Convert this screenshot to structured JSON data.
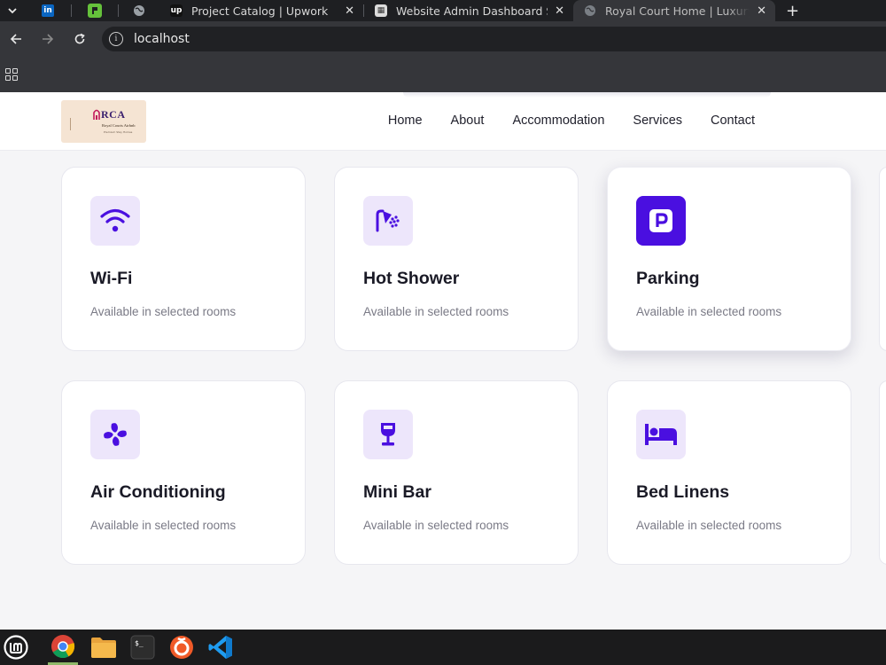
{
  "browser": {
    "pinned_tabs": [
      {
        "icon": "linkedin-icon",
        "label": "in",
        "color": "#0a66c2"
      },
      {
        "icon": "green-app-icon",
        "label": "",
        "color": "#65c13b"
      }
    ],
    "tabs": [
      {
        "title": "Project Catalog | Upwork",
        "icon": "upwork-icon",
        "active": false
      },
      {
        "title": "Website Admin Dashboard S",
        "icon": "dashboard-icon",
        "active": false
      },
      {
        "title": "Royal Court Home | Luxury A",
        "icon": "globe-icon",
        "active": true
      }
    ],
    "address": "localhost"
  },
  "site": {
    "logo": {
      "mark": "RCA",
      "name": "Royal Courts Airbnb",
      "tagline": "Premium Stay Homes"
    },
    "nav": [
      "Home",
      "About",
      "Accommodation",
      "Services",
      "Contact"
    ]
  },
  "amenities": [
    {
      "title": "Wi-Fi",
      "desc": "Available in selected rooms",
      "icon": "wifi-icon"
    },
    {
      "title": "Hot Shower",
      "desc": "Available in selected rooms",
      "icon": "shower-icon"
    },
    {
      "title": "Parking",
      "desc": "Available in selected rooms",
      "icon": "parking-icon",
      "highlighted": true
    },
    {
      "title": "Air Conditioning",
      "desc": "Available in selected rooms",
      "icon": "fan-icon"
    },
    {
      "title": "Mini Bar",
      "desc": "Available in selected rooms",
      "icon": "wine-glass-icon"
    },
    {
      "title": "Bed Linens",
      "desc": "Available in selected rooms",
      "icon": "bed-icon"
    }
  ],
  "colors": {
    "accent": "#4a0fe0",
    "icon_bg": "#ede6fb",
    "card_border": "#e7e7ee"
  },
  "taskbar": [
    "mint-menu-icon",
    "chrome-icon",
    "files-icon",
    "terminal-icon",
    "app-icon",
    "vscode-icon"
  ]
}
